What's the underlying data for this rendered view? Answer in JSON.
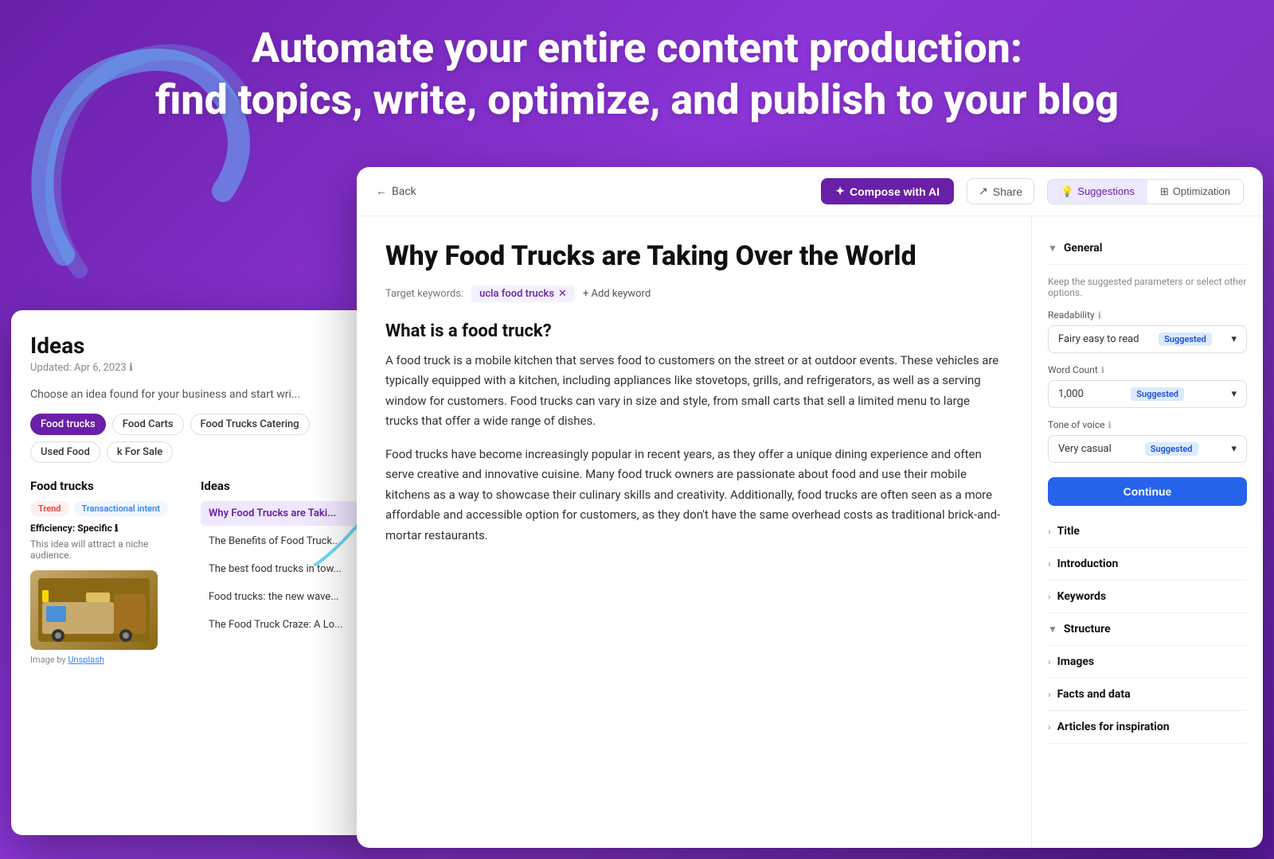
{
  "header": {
    "line1": "Automate your entire content production:",
    "line2": "find topics, write, optimize, and publish to your blog"
  },
  "ideas_panel": {
    "title": "Ideas",
    "updated": "Updated: Apr 6, 2023",
    "updated_icon": "ℹ",
    "subtitle": "Choose an idea found for your business and start wri...",
    "tags": [
      "Food trucks",
      "Food Carts",
      "Food Trucks Catering",
      "Used Food",
      "k For Sale"
    ],
    "active_tag": "Food trucks",
    "left_col": {
      "title": "Food trucks",
      "badges": [
        "Trend",
        "Transactional intent"
      ],
      "efficiency_label": "Efficiency:",
      "efficiency_value": "Specific",
      "niche_text": "This idea will attract a niche audience.",
      "image_credit_text": "Image by",
      "image_credit_link": "Unsplash"
    },
    "right_col": {
      "title": "Ideas",
      "items": [
        {
          "text": "Why Food Trucks are Taki...",
          "active": true
        },
        {
          "text": "The Benefits of Food Truck...",
          "active": false
        },
        {
          "text": "The best food trucks in tow...",
          "active": false
        },
        {
          "text": "Food trucks: the new wave...",
          "active": false
        },
        {
          "text": "The Food Truck Craze: A Lo...",
          "active": false
        }
      ]
    }
  },
  "editor": {
    "back_label": "Back",
    "compose_label": "Compose with AI",
    "share_label": "Share",
    "tab_suggestions": "Suggestions",
    "tab_optimization": "Optimization",
    "article_title": "Why Food Trucks are Taking Over the World",
    "keywords_label": "Target keywords:",
    "keyword_chip": "ucla food trucks",
    "add_keyword_label": "+ Add keyword",
    "section1_heading": "What is a food truck?",
    "body_paragraph1": "A food truck is a mobile kitchen that serves food to customers on the street or at outdoor events. These vehicles are typically equipped with a kitchen, including appliances like stovetops, grills, and refrigerators, as well as a serving window for customers. Food trucks can vary in size and style, from small carts that sell a limited menu to large trucks that offer a wide range of dishes.",
    "body_paragraph2": "Food trucks have become increasingly popular in recent years, as they offer a unique dining experience and often serve creative and innovative cuisine. Many food truck owners are passionate about food and use their mobile kitchens as a way to showcase their culinary skills and creativity. Additionally, food trucks are often seen as a more affordable and accessible option for customers, as they don't have the same overhead costs as traditional brick-and-mortar restaurants."
  },
  "sidebar": {
    "general_section": {
      "title": "General",
      "desc": "Keep the suggested parameters or select other options.",
      "readability_label": "Readability",
      "readability_value": "Fairy easy to read",
      "readability_suggested": "Suggested",
      "wordcount_label": "Word Count",
      "wordcount_value": "1,000",
      "wordcount_suggested": "Suggested",
      "tone_label": "Tone of voice",
      "tone_value": "Very casual",
      "tone_suggested": "Suggested",
      "continue_label": "Continue"
    },
    "sections": [
      {
        "title": "Title",
        "expanded": false
      },
      {
        "title": "Introduction",
        "expanded": false
      },
      {
        "title": "Keywords",
        "expanded": false
      },
      {
        "title": "Structure",
        "expanded": true
      },
      {
        "title": "Images",
        "expanded": false
      },
      {
        "title": "Facts and data",
        "expanded": false
      },
      {
        "title": "Articles for inspiration",
        "expanded": false
      }
    ]
  }
}
